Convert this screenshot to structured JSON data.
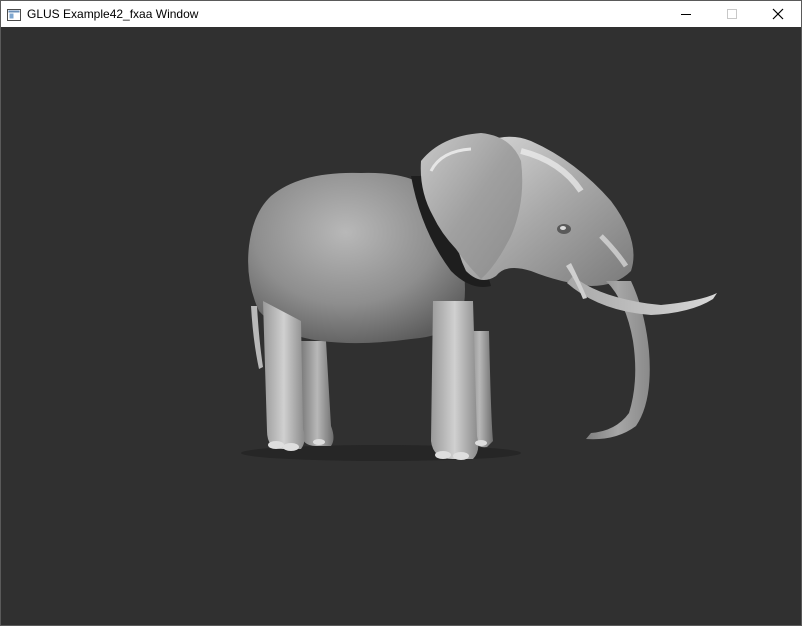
{
  "window": {
    "title": "GLUS Example42_fxaa Window",
    "icon": "window-app-icon",
    "controls": {
      "minimize_icon": "minimize-icon",
      "maximize_icon": "maximize-icon",
      "close_icon": "close-icon",
      "maximize_enabled": false
    }
  },
  "scene": {
    "background_color": "#303030",
    "model": "elephant",
    "shading": "grayscale-phong",
    "model_color": "#9a9a9a"
  }
}
